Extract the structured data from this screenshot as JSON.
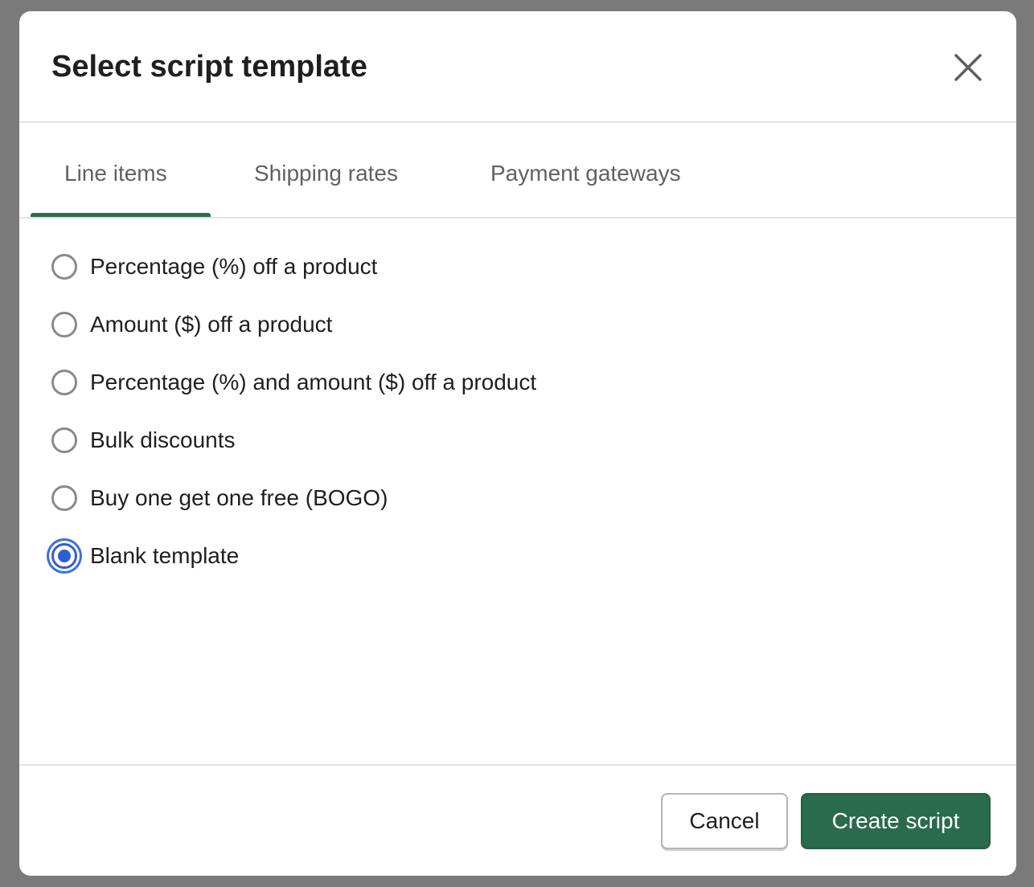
{
  "dialog": {
    "title": "Select script template",
    "close_icon": "close-icon"
  },
  "tabs": [
    {
      "label": "Line items",
      "active": true
    },
    {
      "label": "Shipping rates",
      "active": false
    },
    {
      "label": "Payment gateways",
      "active": false
    }
  ],
  "options": [
    {
      "label": "Percentage (%) off a product",
      "checked": false
    },
    {
      "label": "Amount ($) off a product",
      "checked": false
    },
    {
      "label": "Percentage (%) and amount ($) off a product",
      "checked": false
    },
    {
      "label": "Bulk discounts",
      "checked": false
    },
    {
      "label": "Buy one get one free (BOGO)",
      "checked": false
    },
    {
      "label": "Blank template",
      "checked": true
    }
  ],
  "footer": {
    "cancel_label": "Cancel",
    "create_label": "Create script"
  },
  "colors": {
    "accent": "#2a6a4d",
    "tab_indicator": "#2b6e4f",
    "radio_selected": "#2f5fd0",
    "backdrop": "#7a7a7a"
  }
}
